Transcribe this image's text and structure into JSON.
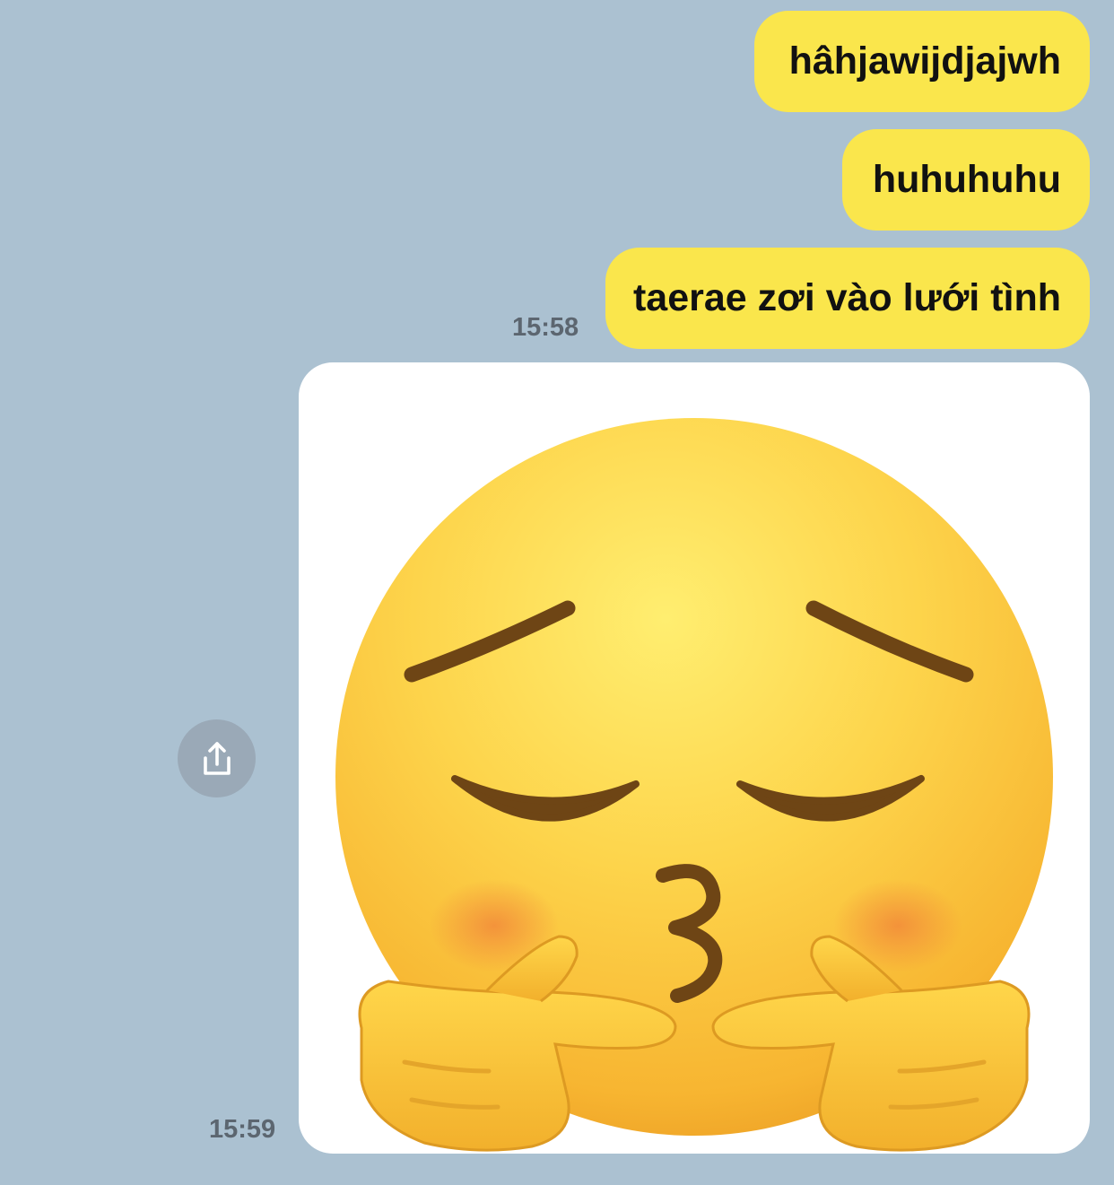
{
  "messages": [
    {
      "text": "hâhjawijdjajwh"
    },
    {
      "text": "huhuhuhu"
    },
    {
      "text": "taerae zơi vào lưới tình",
      "time": "15:58"
    }
  ],
  "image_message": {
    "time": "15:59",
    "content": "kissing-face-with-fingers-emoji"
  },
  "share_button": {
    "icon": "share-icon"
  },
  "colors": {
    "background": "#abc1d1",
    "bubble": "#fae64c",
    "timestamp": "#5c6670",
    "share_button": "#9aa9b7"
  }
}
